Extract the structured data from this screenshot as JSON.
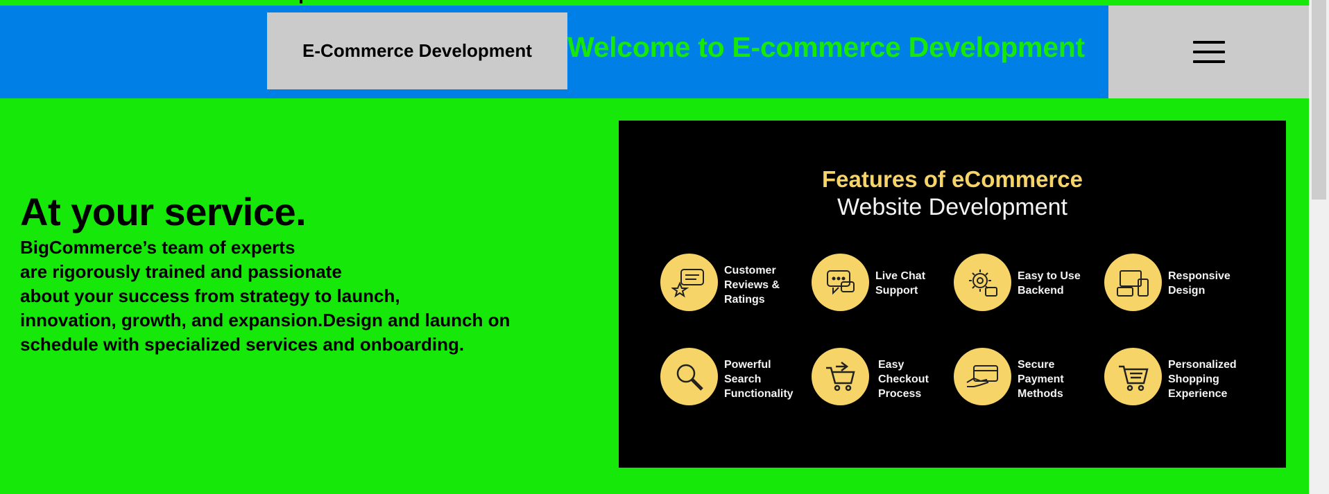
{
  "header": {
    "brand_button_label": "E-Commerce Development",
    "welcome_title": "Welcome to E-commerce Development",
    "menu_icon": "hamburger-menu-icon"
  },
  "hero": {
    "heading": "At your service.",
    "body_lines": [
      "BigCommerce’s team of experts",
      "are rigorously trained and passionate",
      "about your success from strategy to launch,",
      "innovation, growth, and expansion.Design and launch on",
      "schedule with specialized services and onboarding."
    ]
  },
  "feature_image": {
    "title": "Features of eCommerce",
    "subtitle": "Website Development",
    "items": [
      {
        "label": "Customer\nReviews &\nRatings",
        "icon": "review-icon"
      },
      {
        "label": "Live Chat\nSupport",
        "icon": "chat-icon"
      },
      {
        "label": "Easy to Use\nBackend",
        "icon": "gear-icon"
      },
      {
        "label": "Responsive\nDesign",
        "icon": "devices-icon"
      },
      {
        "label": "Powerful\nSearch\nFunctionality",
        "icon": "search-icon"
      },
      {
        "label": "Easy\nCheckout\nProcess",
        "icon": "cart-icon"
      },
      {
        "label": "Secure\nPayment\nMethods",
        "icon": "card-icon"
      },
      {
        "label": "Personalized\nShopping\nExperience",
        "icon": "cart-list-icon"
      }
    ]
  },
  "colors": {
    "page_background": "#16e80a",
    "header_background": "#0080e6",
    "button_background": "#cbcbcb",
    "feature_accent": "#f6d468"
  }
}
